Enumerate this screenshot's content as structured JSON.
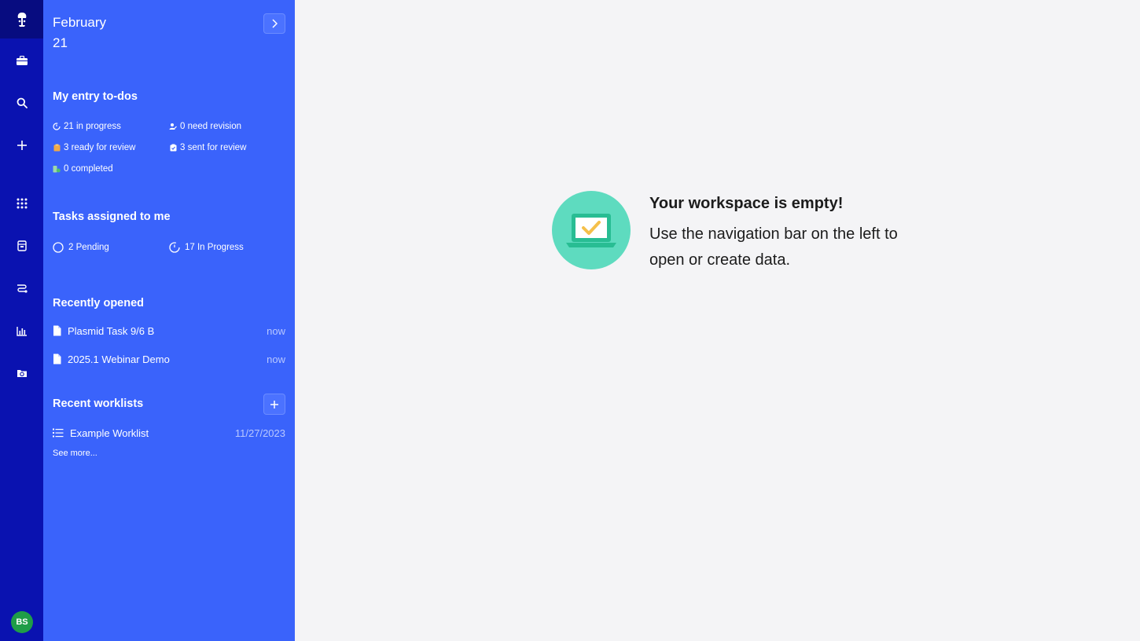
{
  "user": {
    "initials": "BS"
  },
  "header": {
    "month": "February",
    "day": "21"
  },
  "entry_todos": {
    "title": "My entry to-dos",
    "in_progress": "21 in progress",
    "need_revision": "0 need revision",
    "ready_for_review": "3 ready for review",
    "sent_for_review": "3 sent for review",
    "completed": "0 completed"
  },
  "tasks": {
    "title": "Tasks assigned to me",
    "pending": "2 Pending",
    "in_progress": "17 In Progress"
  },
  "recently_opened": {
    "title": "Recently opened",
    "items": [
      {
        "label": "Plasmid Task 9/6 B",
        "time": "now"
      },
      {
        "label": "2025.1 Webinar Demo",
        "time": "now"
      }
    ]
  },
  "worklists": {
    "title": "Recent worklists",
    "items": [
      {
        "label": "Example Worklist",
        "date": "11/27/2023"
      }
    ],
    "see_more": "See more..."
  },
  "empty_state": {
    "title": "Your workspace is empty!",
    "line1": "Use the navigation bar on the left to",
    "line2": "open or create data."
  },
  "colors": {
    "rail": "#0a12b0",
    "panel": "#3a63fb",
    "accent": "#5edbbf",
    "background": "#f4f4f6"
  }
}
